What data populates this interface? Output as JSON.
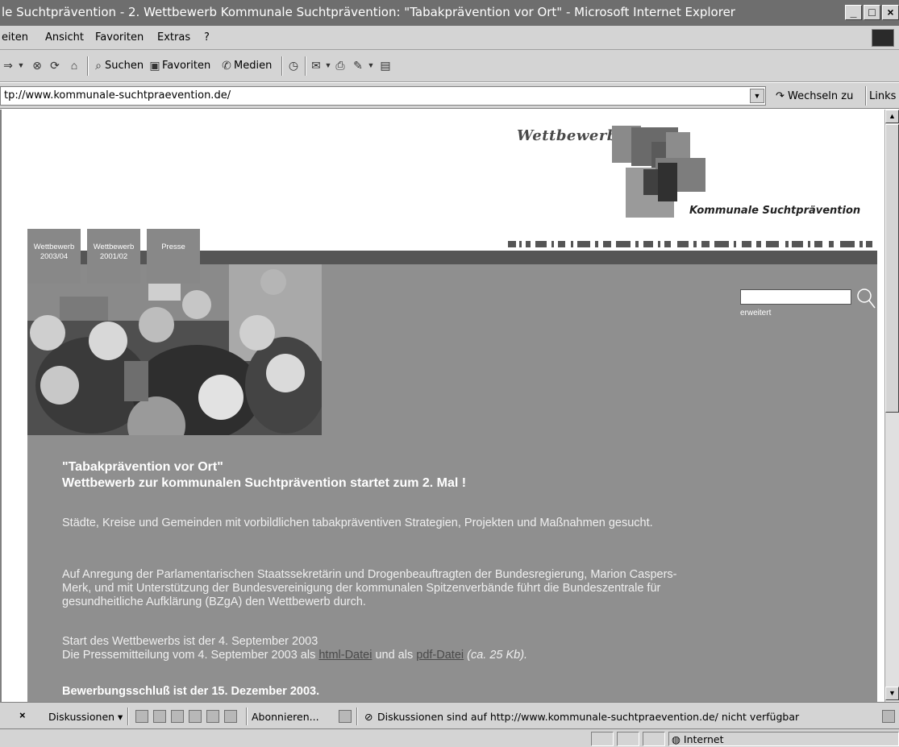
{
  "window": {
    "title": "le Suchtprävention - 2. Wettbewerb Kommunale Suchtprävention: \"Tabakprävention vor Ort\" - Microsoft Internet Explorer",
    "minimize": "_",
    "maximize": "□",
    "close": "×"
  },
  "menubar": {
    "items": [
      "eiten",
      "Ansicht",
      "Favoriten",
      "Extras",
      "?"
    ]
  },
  "toolbar": {
    "search_label": "Suchen",
    "favorites_label": "Favoriten",
    "media_label": "Medien"
  },
  "address": {
    "url": "tp://www.kommunale-suchtpraevention.de/",
    "go_label": "Wechseln zu",
    "links_label": "Links"
  },
  "page": {
    "logo_top": "Wettbewerb",
    "logo_bottom": "Kommunale Suchtprävention",
    "nav_tabs": [
      {
        "line1": "Wettbewerb",
        "line2": "2003/04"
      },
      {
        "line1": "Wettbewerb",
        "line2": "2001/02"
      },
      {
        "line1": "Presse",
        "line2": ""
      }
    ],
    "search": {
      "value": "",
      "advanced_label": "erweitert"
    },
    "headline_1": "\"Tabakprävention vor Ort\"",
    "headline_2": "Wettbewerb zur kommunalen Suchtprävention startet zum 2. Mal !",
    "para_1": "Städte, Kreise und Gemeinden mit vorbildlichen tabakpräventiven Strategien, Projekten und Maßnahmen gesucht.",
    "para_2": "Auf Anregung der Parlamentarischen Staatssekretärin und Drogenbeauftragten der Bundesregierung, Marion Caspers-Merk, und mit Unterstützung der Bundesvereinigung der kommunalen Spitzenverbände führt die Bundeszentrale für gesundheitliche Aufklärung (BZgA) den Wettbewerb durch.",
    "para_3_line1": "Start des Wettbewerbs ist der 4. September 2003",
    "para_3_pre": "Die Pressemitteilung vom 4. September 2003 als ",
    "link_html": "html-Datei",
    "para_3_mid": " und als ",
    "link_pdf": "pdf-Datei",
    "para_3_post": " (ca. 25 Kb).",
    "deadline": "Bewerbungsschluß ist der 15. Dezember 2003."
  },
  "discussion_bar": {
    "close": "×",
    "discussions_label": "Diskussionen ▾",
    "subscribe_label": "Abonnieren...",
    "status_text": "Diskussionen sind auf http://www.kommunale-suchtpraevention.de/ nicht verfügbar"
  },
  "statusbar": {
    "zone": "Internet"
  }
}
